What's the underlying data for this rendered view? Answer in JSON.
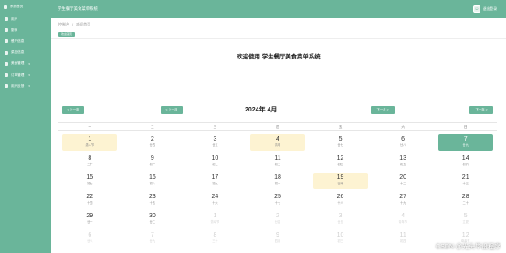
{
  "sidebar": {
    "logo": "系统首页",
    "items": [
      {
        "label": "用户",
        "icon": "user-icon",
        "caret": false
      },
      {
        "label": "厨师",
        "icon": "chef-icon",
        "caret": false
      },
      {
        "label": "餐厅信息",
        "icon": "restaurant-icon",
        "caret": false
      },
      {
        "label": "菜品信息",
        "icon": "dish-icon",
        "caret": false
      },
      {
        "label": "美食管理",
        "icon": "food-icon",
        "caret": true
      },
      {
        "label": "订单管理",
        "icon": "order-icon",
        "caret": true
      },
      {
        "label": "用户反馈",
        "icon": "feedback-icon",
        "caret": true
      }
    ]
  },
  "header": {
    "title": "学生餐厅美食菜单系统",
    "user": "退出登录"
  },
  "breadcrumb": [
    "控制台",
    "/",
    "欢迎首页"
  ],
  "tag": "欢迎首页",
  "welcome": "欢迎使用 学生餐厅美食菜单系统",
  "calendar": {
    "prev_year": "< 上一年",
    "prev_month": "< 上一月",
    "title": "2024年 4月",
    "next_month": "下一月 >",
    "next_year": "下一年 >",
    "weekdays": [
      "一",
      "二",
      "三",
      "四",
      "五",
      "六",
      "日"
    ],
    "days": [
      {
        "n": "1",
        "s": "愚人节",
        "hl": true
      },
      {
        "n": "2",
        "s": "廿四"
      },
      {
        "n": "3",
        "s": "廿五"
      },
      {
        "n": "4",
        "s": "清明",
        "hl": true
      },
      {
        "n": "5",
        "s": "廿七"
      },
      {
        "n": "6",
        "s": "廿八"
      },
      {
        "n": "7",
        "s": "廿九",
        "today": true
      },
      {
        "n": "8",
        "s": "三十"
      },
      {
        "n": "9",
        "s": "初一"
      },
      {
        "n": "10",
        "s": "初二"
      },
      {
        "n": "11",
        "s": "初三"
      },
      {
        "n": "12",
        "s": "初四"
      },
      {
        "n": "13",
        "s": "初五"
      },
      {
        "n": "14",
        "s": "初六"
      },
      {
        "n": "15",
        "s": "初七"
      },
      {
        "n": "16",
        "s": "初八"
      },
      {
        "n": "17",
        "s": "初九"
      },
      {
        "n": "18",
        "s": "初十"
      },
      {
        "n": "19",
        "s": "谷雨",
        "hl": true
      },
      {
        "n": "20",
        "s": "十二"
      },
      {
        "n": "21",
        "s": "十三"
      },
      {
        "n": "22",
        "s": "十四"
      },
      {
        "n": "23",
        "s": "十五"
      },
      {
        "n": "24",
        "s": "十六"
      },
      {
        "n": "25",
        "s": "十七"
      },
      {
        "n": "26",
        "s": "十八"
      },
      {
        "n": "27",
        "s": "十九"
      },
      {
        "n": "28",
        "s": "二十"
      },
      {
        "n": "29",
        "s": "廿一"
      },
      {
        "n": "30",
        "s": "廿二"
      },
      {
        "n": "1",
        "s": "劳动节",
        "faded": true
      },
      {
        "n": "2",
        "s": "廿四",
        "faded": true
      },
      {
        "n": "3",
        "s": "廿五",
        "faded": true
      },
      {
        "n": "4",
        "s": "青年节",
        "faded": true
      },
      {
        "n": "5",
        "s": "立夏",
        "faded": true
      },
      {
        "n": "6",
        "s": "廿八",
        "faded": true
      },
      {
        "n": "7",
        "s": "廿九",
        "faded": true
      },
      {
        "n": "8",
        "s": "三十",
        "faded": true
      },
      {
        "n": "9",
        "s": "四月",
        "faded": true
      },
      {
        "n": "10",
        "s": "初三",
        "faded": true
      },
      {
        "n": "11",
        "s": "初四",
        "faded": true
      },
      {
        "n": "12",
        "s": "母亲节",
        "faded": true
      }
    ]
  },
  "watermark": "CSDN @光头毕设程序",
  "colors": {
    "accent": "#6ab59a",
    "highlight": "#fdf3d2"
  }
}
